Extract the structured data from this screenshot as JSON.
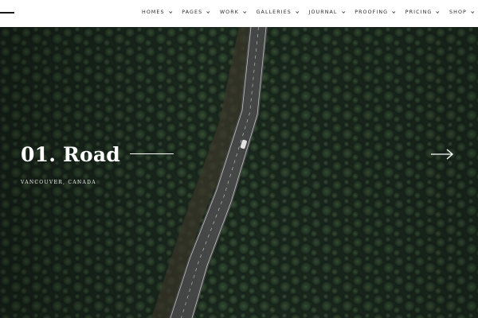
{
  "nav": {
    "items": [
      {
        "label": "HOMES"
      },
      {
        "label": "PAGES"
      },
      {
        "label": "WORK"
      },
      {
        "label": "GALLERIES"
      },
      {
        "label": "JOURNAL"
      },
      {
        "label": "PROOFING"
      },
      {
        "label": "PRICING"
      },
      {
        "label": "SHOP"
      }
    ]
  },
  "slide": {
    "title": "01. Road",
    "subtitle": "VANCOUVER, CANADA"
  },
  "icons": {
    "menu": "hamburger-icon",
    "next": "arrow-right-icon",
    "nav_caret": "chevron-down-icon"
  },
  "colors": {
    "forest_dark": "#16231a",
    "forest_mid": "#2b3d2c",
    "road": "#4a4c4c",
    "text_light": "#ffffff"
  }
}
